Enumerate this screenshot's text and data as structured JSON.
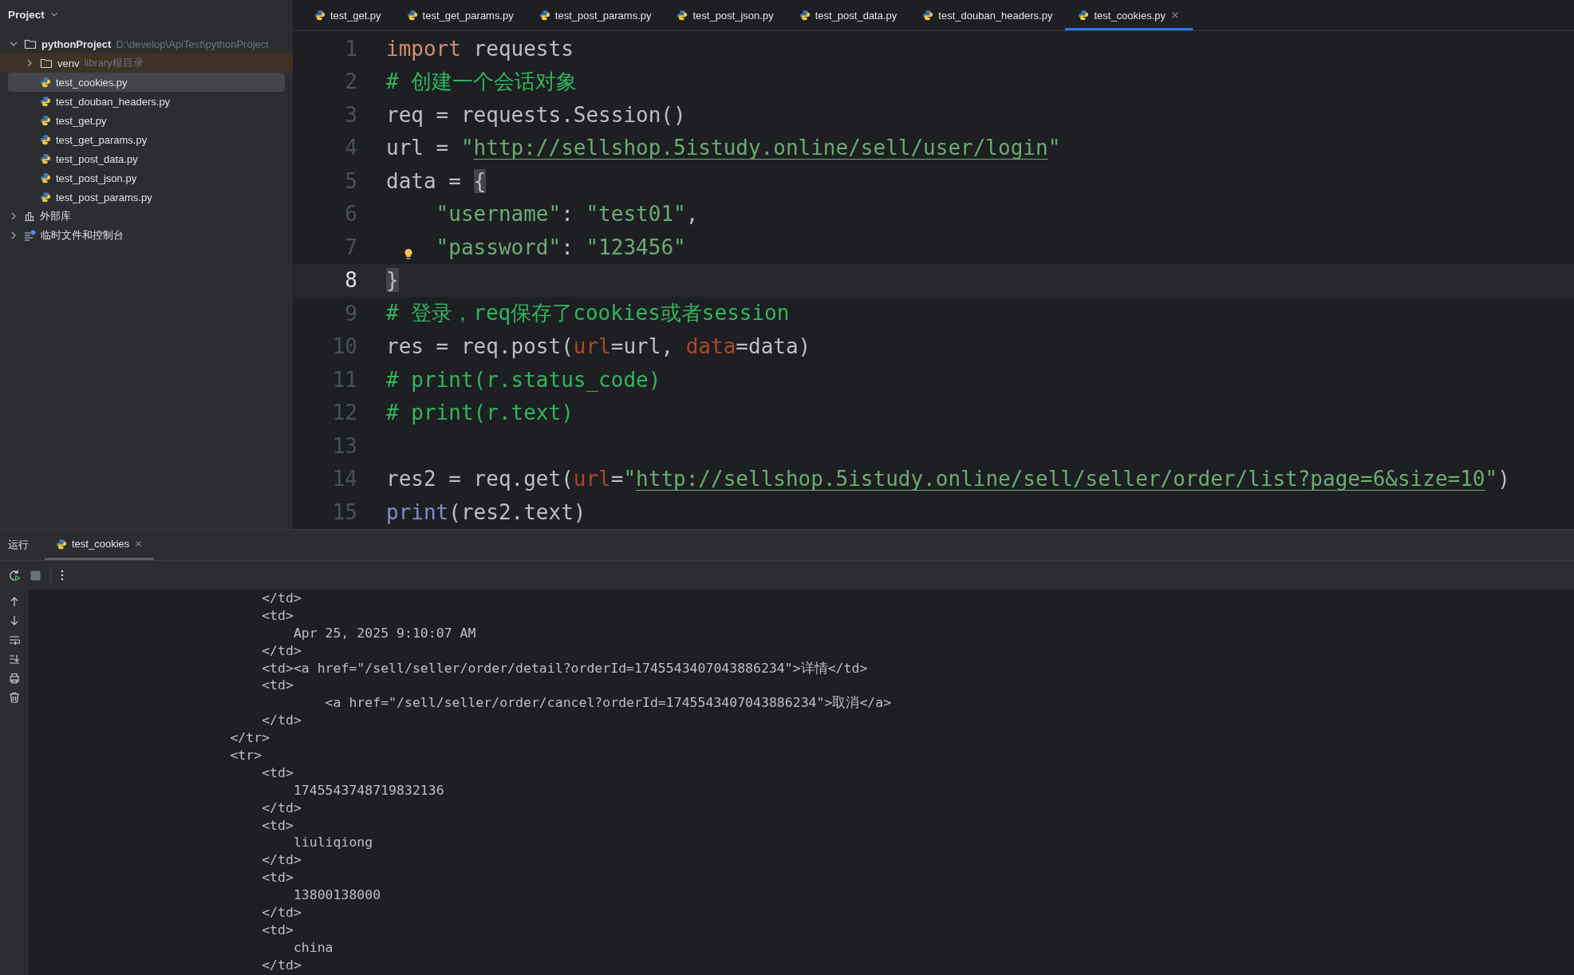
{
  "project_panel": {
    "title": "Project",
    "tree": [
      {
        "label": "pythonProject",
        "path": "D:\\develop\\ApiTest\\pythonProject",
        "kind": "project",
        "expanded": true,
        "selected": false,
        "children": [
          {
            "label": "venv",
            "note": "library根目录",
            "kind": "library_folder",
            "expanded": false,
            "selected": false
          },
          {
            "label": "test_cookies.py",
            "kind": "python",
            "selected": true
          },
          {
            "label": "test_douban_headers.py",
            "kind": "python",
            "selected": false
          },
          {
            "label": "test_get.py",
            "kind": "python",
            "selected": false
          },
          {
            "label": "test_get_params.py",
            "kind": "python",
            "selected": false
          },
          {
            "label": "test_post_data.py",
            "kind": "python",
            "selected": false
          },
          {
            "label": "test_post_json.py",
            "kind": "python",
            "selected": false
          },
          {
            "label": "test_post_params.py",
            "kind": "python",
            "selected": false
          }
        ]
      },
      {
        "label": "外部库",
        "kind": "libraries",
        "expanded": false,
        "selected": false
      },
      {
        "label": "临时文件和控制台",
        "kind": "scratches",
        "expanded": false,
        "selected": false
      }
    ]
  },
  "editor_tabs": [
    {
      "label": "test_get.py",
      "selected": false
    },
    {
      "label": "test_get_params.py",
      "selected": false
    },
    {
      "label": "test_post_params.py",
      "selected": false
    },
    {
      "label": "test_post_json.py",
      "selected": false
    },
    {
      "label": "test_post_data.py",
      "selected": false
    },
    {
      "label": "test_douban_headers.py",
      "selected": false
    },
    {
      "label": "test_cookies.py",
      "selected": true
    }
  ],
  "code_lines": [
    {
      "number": "1",
      "current": false,
      "tokens": [
        {
          "text": "import",
          "kind": "keyword"
        },
        {
          "text": " requests",
          "kind": "plain"
        }
      ]
    },
    {
      "number": "2",
      "current": false,
      "tokens": [
        {
          "text": "# 创建一个会话对象",
          "kind": "comment"
        }
      ]
    },
    {
      "number": "3",
      "current": false,
      "tokens": [
        {
          "text": "req = requests.Session()",
          "kind": "plain"
        }
      ]
    },
    {
      "number": "4",
      "current": false,
      "tokens": [
        {
          "text": "url = ",
          "kind": "plain"
        },
        {
          "text": "\"",
          "kind": "string"
        },
        {
          "text": "http://sellshop.5istudy.online/sell/user/login",
          "kind": "url"
        },
        {
          "text": "\"",
          "kind": "string"
        }
      ]
    },
    {
      "number": "5",
      "current": false,
      "tokens": [
        {
          "text": "data = ",
          "kind": "plain"
        },
        {
          "text": "{",
          "kind": "matched_brace"
        }
      ]
    },
    {
      "number": "6",
      "current": false,
      "tokens": [
        {
          "text": "    \"username\"",
          "kind": "string"
        },
        {
          "text": ": ",
          "kind": "plain"
        },
        {
          "text": "\"test01\"",
          "kind": "string"
        },
        {
          "text": ",",
          "kind": "plain"
        }
      ]
    },
    {
      "number": "7",
      "current": false,
      "bulb": true,
      "tokens": [
        {
          "text": "    \"password\"",
          "kind": "string"
        },
        {
          "text": ": ",
          "kind": "plain"
        },
        {
          "text": "\"123456\"",
          "kind": "string"
        }
      ]
    },
    {
      "number": "8",
      "current": true,
      "tokens": [
        {
          "text": "}",
          "kind": "matched_brace"
        }
      ]
    },
    {
      "number": "9",
      "current": false,
      "tokens": [
        {
          "text": "# 登录，req保存了cookies或者session",
          "kind": "comment"
        }
      ]
    },
    {
      "number": "10",
      "current": false,
      "tokens": [
        {
          "text": "res = req.post(",
          "kind": "plain"
        },
        {
          "text": "url",
          "kind": "param"
        },
        {
          "text": "=url, ",
          "kind": "plain"
        },
        {
          "text": "data",
          "kind": "param"
        },
        {
          "text": "=data)",
          "kind": "plain"
        }
      ]
    },
    {
      "number": "11",
      "current": false,
      "tokens": [
        {
          "text": "# print(r.status_code)",
          "kind": "comment"
        }
      ]
    },
    {
      "number": "12",
      "current": false,
      "tokens": [
        {
          "text": "# print(r.text)",
          "kind": "comment"
        }
      ]
    },
    {
      "number": "13",
      "current": false
    },
    {
      "number": "14",
      "current": false,
      "tokens": [
        {
          "text": "res2 = req.get(",
          "kind": "plain"
        },
        {
          "text": "url",
          "kind": "param"
        },
        {
          "text": "=",
          "kind": "plain"
        },
        {
          "text": "\"",
          "kind": "string"
        },
        {
          "text": "http://sellshop.5istudy.online/sell/seller/order/list?page=6&size=10",
          "kind": "url"
        },
        {
          "text": "\"",
          "kind": "string"
        },
        {
          "text": ")",
          "kind": "plain"
        }
      ]
    },
    {
      "number": "15",
      "current": false,
      "tokens": [
        {
          "text": "print",
          "kind": "builtin"
        },
        {
          "text": "(res2.text)",
          "kind": "plain"
        }
      ]
    }
  ],
  "run_panel": {
    "title": "运行",
    "tabs": [
      {
        "label": "test_cookies",
        "selected": true
      }
    ],
    "console_lines": [
      "                            </td>",
      "                            <td>",
      "                                Apr 25, 2025 9:10:07 AM",
      "                            </td>",
      "                            <td><a href=\"/sell/seller/order/detail?orderId=1745543407043886234\">详情</td>",
      "                            <td>",
      "                                    <a href=\"/sell/seller/order/cancel?orderId=1745543407043886234\">取消</a>",
      "                            </td>",
      "                        </tr>",
      "                        <tr>",
      "                            <td>",
      "                                1745543748719832136",
      "                            </td>",
      "                            <td>",
      "                                liuliqiong",
      "                            </td>",
      "                            <td>",
      "                                13800138000",
      "                            </td>",
      "                            <td>",
      "                                china",
      "                            </td>"
    ]
  }
}
